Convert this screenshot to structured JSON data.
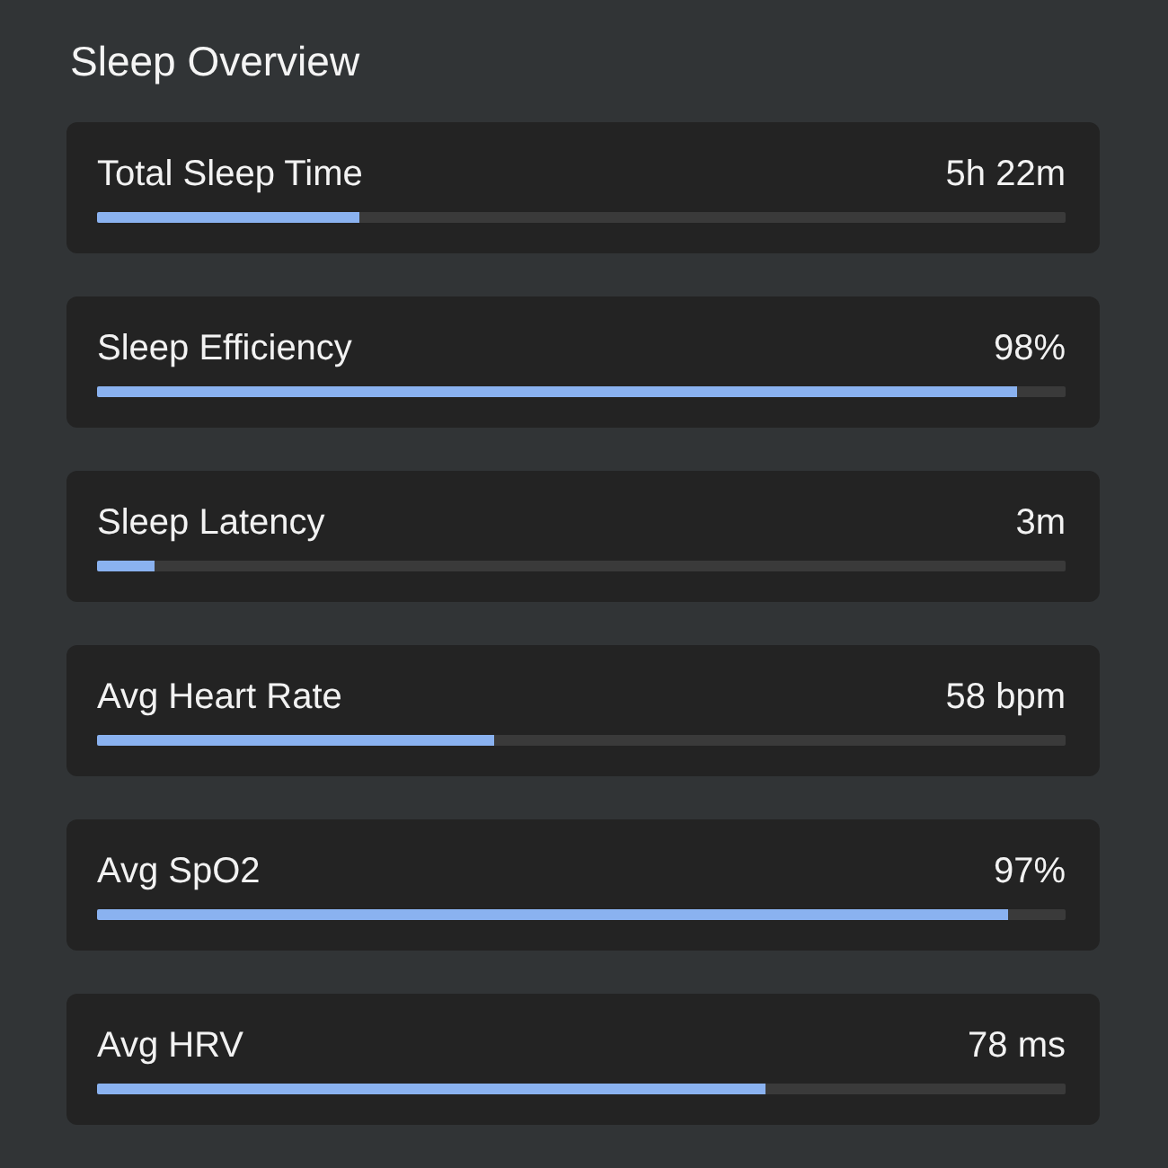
{
  "title": "Sleep Overview",
  "metrics": [
    {
      "label": "Total Sleep Time",
      "value": "5h 22m",
      "level": 0.27
    },
    {
      "label": "Sleep Efficiency",
      "value": "98%",
      "level": 0.95
    },
    {
      "label": "Sleep Latency",
      "value": "3m",
      "level": 0.06
    },
    {
      "label": "Avg Heart Rate",
      "value": "58 bpm",
      "level": 0.41
    },
    {
      "label": "Avg SpO2",
      "value": "97%",
      "level": 0.94
    },
    {
      "label": "Avg HRV",
      "value": "78 ms",
      "level": 0.69
    }
  ]
}
